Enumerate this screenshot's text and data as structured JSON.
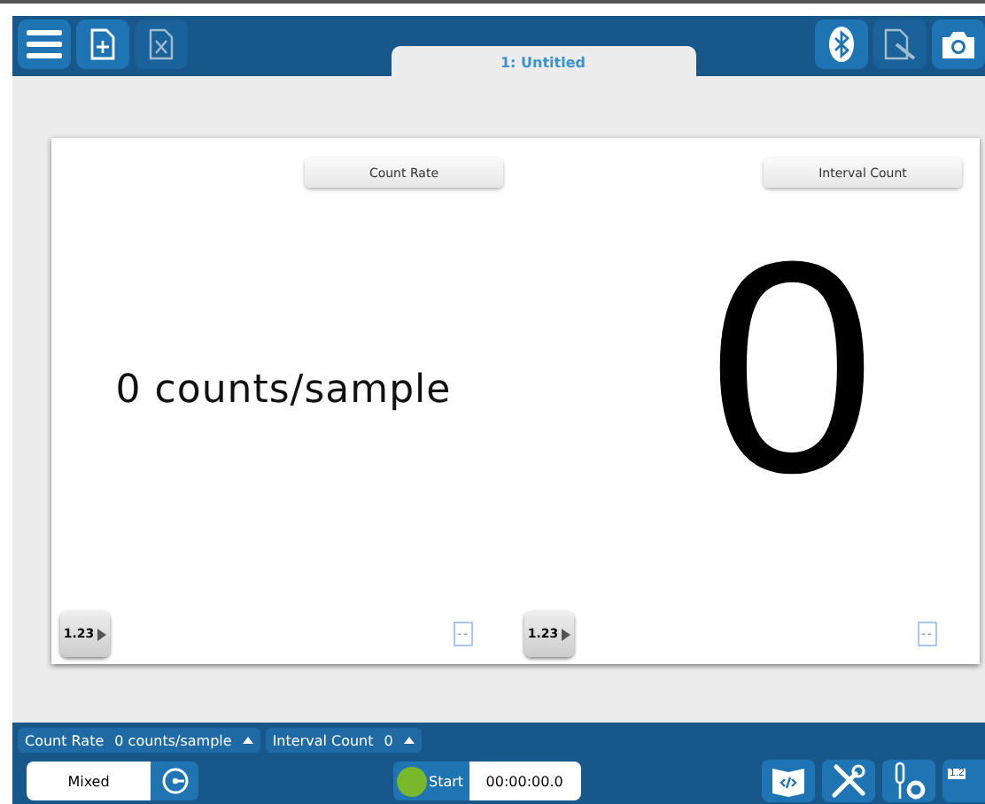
{
  "toolbar": {
    "left_buttons": [
      {
        "kind": "menu",
        "disabled": false
      },
      {
        "kind": "new-file",
        "disabled": false
      },
      {
        "kind": "spreadsheet",
        "disabled": true
      }
    ],
    "tab": {
      "label": "1: Untitled",
      "selected": true
    },
    "right_buttons": [
      {
        "kind": "bluetooth",
        "disabled": false
      },
      {
        "kind": "graph-file",
        "disabled": true
      },
      {
        "kind": "camera",
        "disabled": false
      }
    ]
  },
  "displays": [
    {
      "kind": "text",
      "title": "Count Rate",
      "value": "0 counts/sample",
      "format_button": "1.23",
      "placeholder_value": "--"
    },
    {
      "kind": "big",
      "title": "Interval Count",
      "value": "0",
      "format_button": "1.23",
      "placeholder_value": "--"
    }
  ],
  "status_bar": {
    "meters": [
      {
        "label": "Count Rate",
        "value": "0 counts/sample"
      },
      {
        "label": "Interval Count",
        "value": "0"
      }
    ],
    "mode": "Mixed",
    "start_label": "Start",
    "timer": "00:00:00.0",
    "corner_label": "1.2"
  }
}
